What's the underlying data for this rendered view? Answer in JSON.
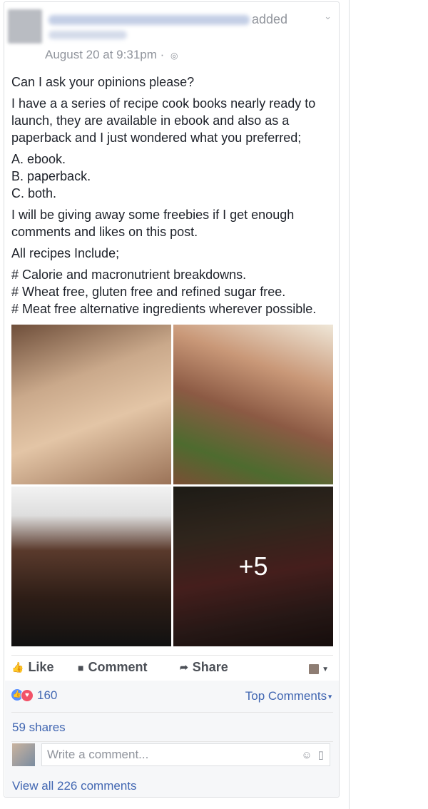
{
  "header": {
    "added_text": "added",
    "timestamp": "August 20 at 9:31pm",
    "separator": " · ",
    "privacy_icon": "globe-icon"
  },
  "post": {
    "line1": "Can I ask your opinions please?",
    "line2": "I have a a series of recipe cook books nearly ready to launch, they are available in ebook and also as a paperback and I just wondered what you preferred;",
    "option_a": "A. ebook.",
    "option_b": "B. paperback.",
    "option_c": "C. both.",
    "line3": "I will be giving away some freebies if I get enough comments and likes on this post.",
    "line4": "All recipes Include;",
    "bullet1": "# Calorie and macronutrient breakdowns.",
    "bullet2": "# Wheat free, gluten free and refined sugar free.",
    "bullet3": "# Meat free alternative ingredients wherever possible."
  },
  "photos": {
    "more_count": "+5"
  },
  "actions": {
    "like": "Like",
    "comment": "Comment",
    "share": "Share"
  },
  "reactions": {
    "count": "160",
    "top_comments": "Top Comments"
  },
  "shares": "59 shares",
  "comment_box": {
    "placeholder": "Write a comment..."
  },
  "view_all": "View all 226 comments"
}
